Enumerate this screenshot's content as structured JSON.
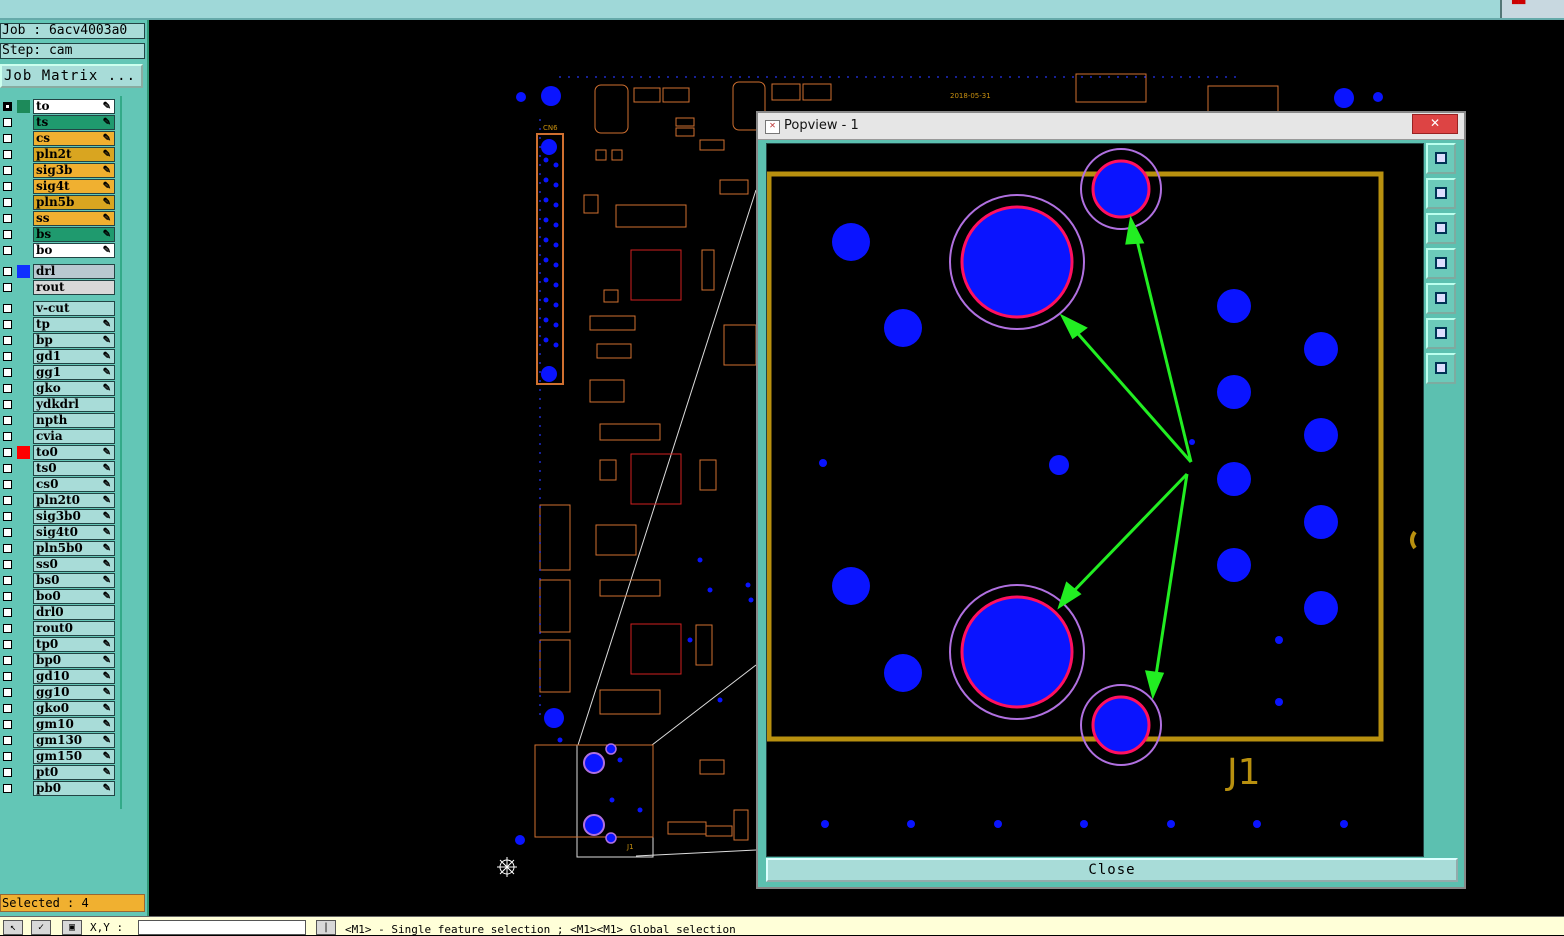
{
  "header": {
    "job_label": "Job : 6acv4003a0",
    "step_label": "Step: cam",
    "job_matrix_button": "Job Matrix ..."
  },
  "layers_group1": [
    {
      "name": "to",
      "color": "#ffffff",
      "swatch": "#1d8a5a",
      "checked": true
    },
    {
      "name": "ts",
      "color": "#1f9a6e",
      "swatch": "",
      "checked": false
    },
    {
      "name": "cs",
      "color": "#f0b030",
      "swatch": "",
      "checked": false
    },
    {
      "name": "pln2t",
      "color": "#d9a520",
      "swatch": "",
      "checked": false
    },
    {
      "name": "sig3b",
      "color": "#f0b030",
      "swatch": "",
      "checked": false
    },
    {
      "name": "sig4t",
      "color": "#f0b030",
      "swatch": "",
      "checked": false
    },
    {
      "name": "pln5b",
      "color": "#d9a520",
      "swatch": "",
      "checked": false
    },
    {
      "name": "ss",
      "color": "#f0b030",
      "swatch": "",
      "checked": false
    },
    {
      "name": "bs",
      "color": "#1f9a6e",
      "swatch": "",
      "checked": false
    },
    {
      "name": "bo",
      "color": "#ffffff",
      "swatch": "",
      "checked": false
    }
  ],
  "layers_group2": [
    {
      "name": "drl",
      "color": "#b8c8d0",
      "swatch": "#1030ff",
      "checked": false
    },
    {
      "name": "rout",
      "color": "#d8d8d8",
      "swatch": "",
      "checked": false
    }
  ],
  "layers_group3": [
    {
      "name": "v-cut",
      "swatch": "",
      "checked": false
    },
    {
      "name": "tp",
      "swatch": "",
      "checked": false
    },
    {
      "name": "bp",
      "swatch": "",
      "checked": false
    },
    {
      "name": "gd1",
      "swatch": "",
      "checked": false
    },
    {
      "name": "gg1",
      "swatch": "",
      "checked": false
    },
    {
      "name": "gko",
      "swatch": "",
      "checked": false
    },
    {
      "name": "ydkdrl",
      "swatch": "",
      "checked": false
    },
    {
      "name": "npth",
      "swatch": "",
      "checked": false
    },
    {
      "name": "cvia",
      "swatch": "",
      "checked": false
    },
    {
      "name": "to0",
      "swatch": "#ff0000",
      "checked": false
    },
    {
      "name": "ts0",
      "swatch": "",
      "checked": false
    },
    {
      "name": "cs0",
      "swatch": "",
      "checked": false
    },
    {
      "name": "pln2t0",
      "swatch": "",
      "checked": false
    },
    {
      "name": "sig3b0",
      "swatch": "",
      "checked": false
    },
    {
      "name": "sig4t0",
      "swatch": "",
      "checked": false
    },
    {
      "name": "pln5b0",
      "swatch": "",
      "checked": false
    },
    {
      "name": "ss0",
      "swatch": "",
      "checked": false
    },
    {
      "name": "bs0",
      "swatch": "",
      "checked": false
    },
    {
      "name": "bo0",
      "swatch": "",
      "checked": false
    },
    {
      "name": "drl0",
      "swatch": "",
      "checked": false
    },
    {
      "name": "rout0",
      "swatch": "",
      "checked": false
    },
    {
      "name": "tp0",
      "swatch": "",
      "checked": false
    },
    {
      "name": "bp0",
      "swatch": "",
      "checked": false
    },
    {
      "name": "gd10",
      "swatch": "",
      "checked": false
    },
    {
      "name": "gg10",
      "swatch": "",
      "checked": false
    },
    {
      "name": "gko0",
      "swatch": "",
      "checked": false
    },
    {
      "name": "gm10",
      "swatch": "",
      "checked": false
    },
    {
      "name": "gm130",
      "swatch": "",
      "checked": false
    },
    {
      "name": "gm150",
      "swatch": "",
      "checked": false
    },
    {
      "name": "pt0",
      "swatch": "",
      "checked": false
    },
    {
      "name": "pb0",
      "swatch": "",
      "checked": false
    }
  ],
  "status": {
    "selected": "Selected : 4",
    "xy_label": "X,Y :",
    "hint": "<M1> - Single feature selection ; <M1><M1> Global selection"
  },
  "popview": {
    "title": "Popview - 1",
    "close_x": "✕",
    "close_button": "Close",
    "component_label": "J1"
  },
  "board_labels": {
    "date": "2018-05-31",
    "cn6": "CN6",
    "j1": "J1"
  },
  "colors": {
    "outline": "#b8900f",
    "pad": "#0a14ff",
    "ring_red": "#ff1060",
    "ring_violet": "#b070e0",
    "arrow": "#22ee22",
    "comp": "#d07030"
  }
}
